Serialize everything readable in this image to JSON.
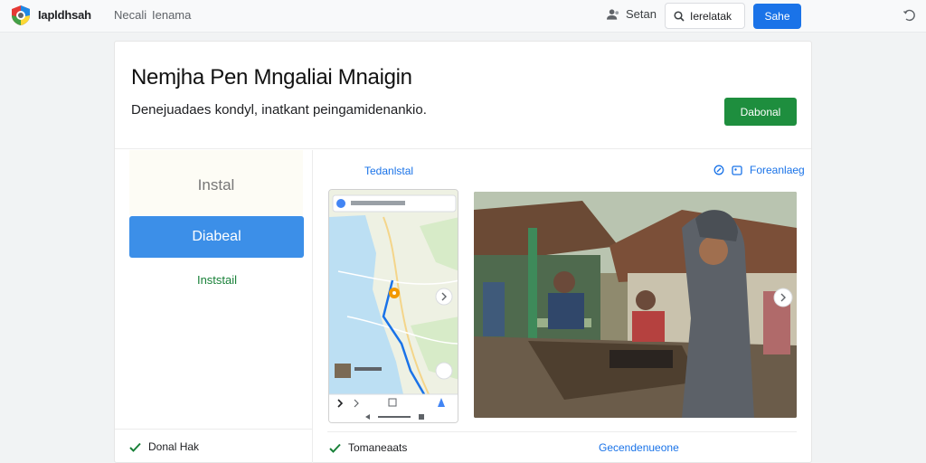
{
  "topbar": {
    "brand": "Iapldhsah",
    "nav": [
      "Necali",
      "Ienama"
    ],
    "user_label": "Setan",
    "search_label": "Ierelatak",
    "share_label": "Sahe"
  },
  "header": {
    "title": "Nemjha Pen Mngaliai Mnaigin",
    "subtitle": "Denejuadaes kondyl, inatkant peingamidenankio.",
    "action_button": "Dabonal"
  },
  "left": {
    "install_title": "Instal",
    "download_button": "Diabeal",
    "install_link": "Inststail",
    "footer_item": "Donal Hak"
  },
  "right": {
    "section_label": "Tedanlstal",
    "top_action": "Foreanlaeg",
    "footer_left": "Tomaneaats",
    "footer_right": "Gecendenueone"
  },
  "colors": {
    "accent": "#1a73e8",
    "green": "#1e8e3e",
    "download": "#3c8fe8"
  }
}
